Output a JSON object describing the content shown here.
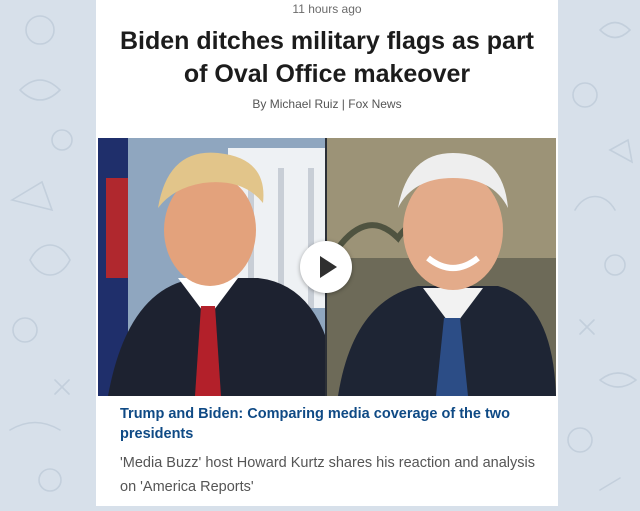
{
  "article": {
    "timestamp": "11 hours ago",
    "headline": "Biden ditches military flags as part of Oval Office makeover",
    "byline": "By Michael Ruiz | Fox News"
  },
  "video": {
    "title": "Trump and Biden: Comparing media coverage of the two presidents",
    "description": "'Media Buzz' host Howard Kurtz shares his reaction and analysis on 'America Reports'",
    "play_icon": "play-icon"
  },
  "colors": {
    "background": "#d7e0ea",
    "card": "#ffffff",
    "headline": "#1c1c1c",
    "link": "#0f4a85",
    "muted": "#555555"
  }
}
